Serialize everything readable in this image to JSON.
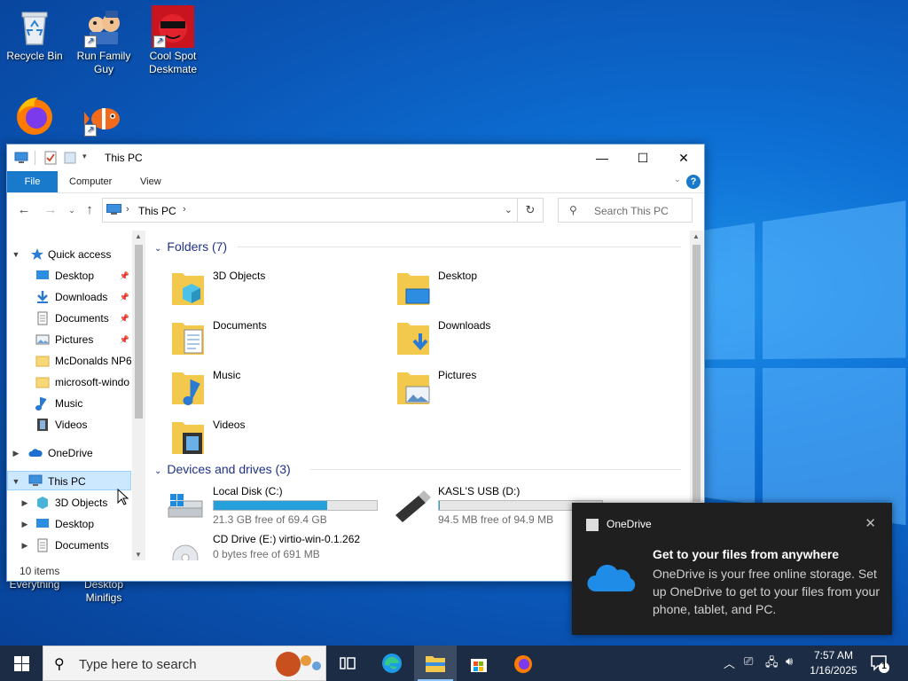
{
  "desktop": {
    "icons": [
      {
        "label": "Recycle Bin"
      },
      {
        "label": "Run Family Guy"
      },
      {
        "label": "Cool Spot Deskmate"
      },
      {
        "label": "Everything"
      },
      {
        "label": "Desktop Minifigs"
      }
    ]
  },
  "explorer": {
    "title": "This PC",
    "ribbon_tabs": [
      "File",
      "Computer",
      "View"
    ],
    "address": {
      "path": "This PC"
    },
    "search": {
      "placeholder": "Search This PC"
    },
    "nav": {
      "quick_access": "Quick access",
      "items": [
        {
          "label": "Desktop",
          "pinned": true
        },
        {
          "label": "Downloads",
          "pinned": true
        },
        {
          "label": "Documents",
          "pinned": true
        },
        {
          "label": "Pictures",
          "pinned": true
        },
        {
          "label": "McDonalds NP6",
          "pinned": false
        },
        {
          "label": "microsoft-windo",
          "pinned": false
        },
        {
          "label": "Music",
          "pinned": false
        },
        {
          "label": "Videos",
          "pinned": false
        }
      ],
      "onedrive": "OneDrive",
      "this_pc": "This PC",
      "this_pc_children": [
        "3D Objects",
        "Desktop",
        "Documents"
      ]
    },
    "folders_header": "Folders (7)",
    "folders": [
      {
        "name": "3D Objects",
        "icon": "3d-objects-icon"
      },
      {
        "name": "Desktop",
        "icon": "desktop-folder-icon"
      },
      {
        "name": "Documents",
        "icon": "documents-folder-icon"
      },
      {
        "name": "Downloads",
        "icon": "downloads-folder-icon"
      },
      {
        "name": "Music",
        "icon": "music-folder-icon"
      },
      {
        "name": "Pictures",
        "icon": "pictures-folder-icon"
      },
      {
        "name": "Videos",
        "icon": "videos-folder-icon"
      }
    ],
    "drives_header": "Devices and drives (3)",
    "drives": [
      {
        "name": "Local Disk (C:)",
        "free": "21.3 GB free of 69.4 GB",
        "used_fraction": 0.693,
        "icon": "local-disk-icon"
      },
      {
        "name": "KASL'S USB (D:)",
        "free": "94.5 MB free of 94.9 MB",
        "used_fraction": 0.004,
        "icon": "usb-drive-icon"
      },
      {
        "name": "CD Drive (E:) virtio-win-0.1.262",
        "free": "0 bytes free of 691 MB",
        "used_fraction": null,
        "icon": "cd-drive-icon"
      }
    ],
    "status": "10 items"
  },
  "toast": {
    "app": "OneDrive",
    "title": "Get to your files from anywhere",
    "body": "OneDrive is your free online storage. Set up OneDrive to get to your files from your phone, tablet, and PC."
  },
  "taskbar": {
    "search_placeholder": "Type here to search",
    "time": "7:57 AM",
    "date": "1/16/2025",
    "notification_count": "1"
  },
  "colors": {
    "accent": "#1979ca",
    "selection": "#cce8ff",
    "drive_bar": "#26a0da",
    "taskbar": "#1b2c44"
  }
}
